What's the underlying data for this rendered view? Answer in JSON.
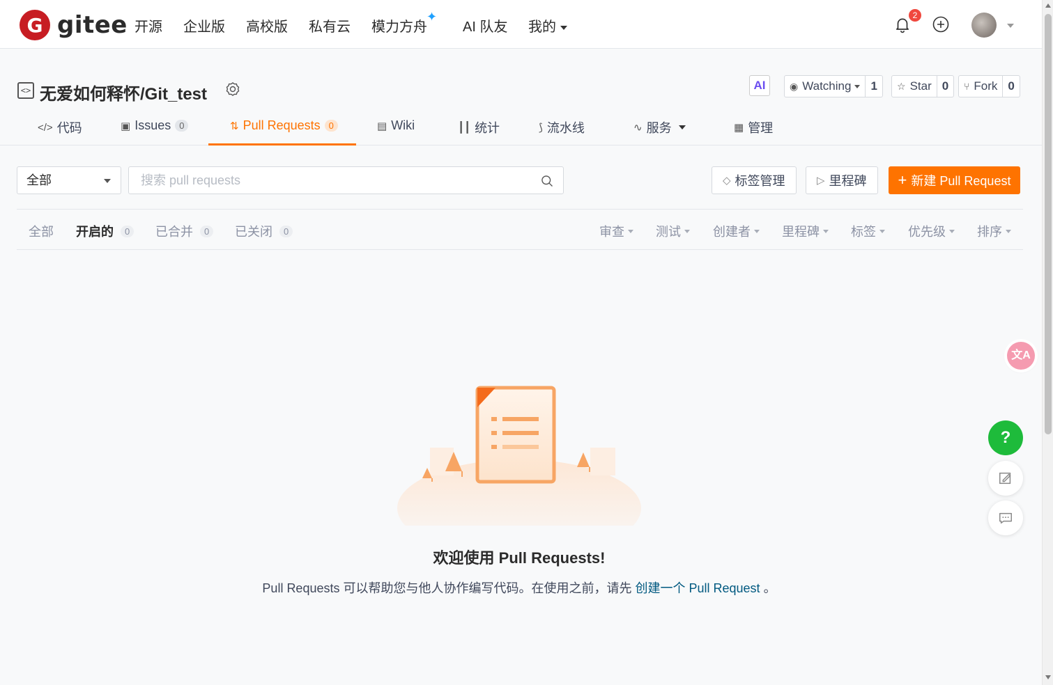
{
  "brand": {
    "logo_letter": "G",
    "name": "gitee"
  },
  "topnav": {
    "items": [
      "开源",
      "企业版",
      "高校版",
      "私有云",
      "模力方舟",
      "AI 队友",
      "我的"
    ],
    "notification_count": "2"
  },
  "repo": {
    "title": "无爱如何释怀/Git_test",
    "ai_label": "AI",
    "watching": {
      "label": "Watching",
      "count": "1"
    },
    "star": {
      "label": "Star",
      "count": "0"
    },
    "fork": {
      "label": "Fork",
      "count": "0"
    }
  },
  "tabs": [
    {
      "label": "代码"
    },
    {
      "label": "Issues",
      "count": "0"
    },
    {
      "label": "Pull Requests",
      "count": "0"
    },
    {
      "label": "Wiki"
    },
    {
      "label": "统计"
    },
    {
      "label": "流水线"
    },
    {
      "label": "服务"
    },
    {
      "label": "管理"
    }
  ],
  "toolbar": {
    "scope_select": "全部",
    "search_placeholder": "搜索 pull requests",
    "labels_button": "标签管理",
    "milestones_button": "里程碑",
    "new_pr_button": "新建 Pull Request"
  },
  "filters": {
    "states": [
      {
        "label": "全部"
      },
      {
        "label": "开启的",
        "count": "0"
      },
      {
        "label": "已合并",
        "count": "0"
      },
      {
        "label": "已关闭",
        "count": "0"
      }
    ],
    "dropdowns": [
      "审查",
      "测试",
      "创建者",
      "里程碑",
      "标签",
      "优先级",
      "排序"
    ]
  },
  "empty_state": {
    "title": "欢迎使用 Pull Requests!",
    "desc_prefix": "Pull Requests 可以帮助您与他人协作编写代码。在使用之前，请先",
    "desc_link": "创建一个 Pull Request",
    "desc_suffix": "。"
  },
  "floating": {
    "translate_label": "文A",
    "help_label": "?"
  },
  "colors": {
    "accent": "#fe7300",
    "brand_red": "#c71d23",
    "help_green": "#1ebb3b",
    "link": "#005980"
  }
}
